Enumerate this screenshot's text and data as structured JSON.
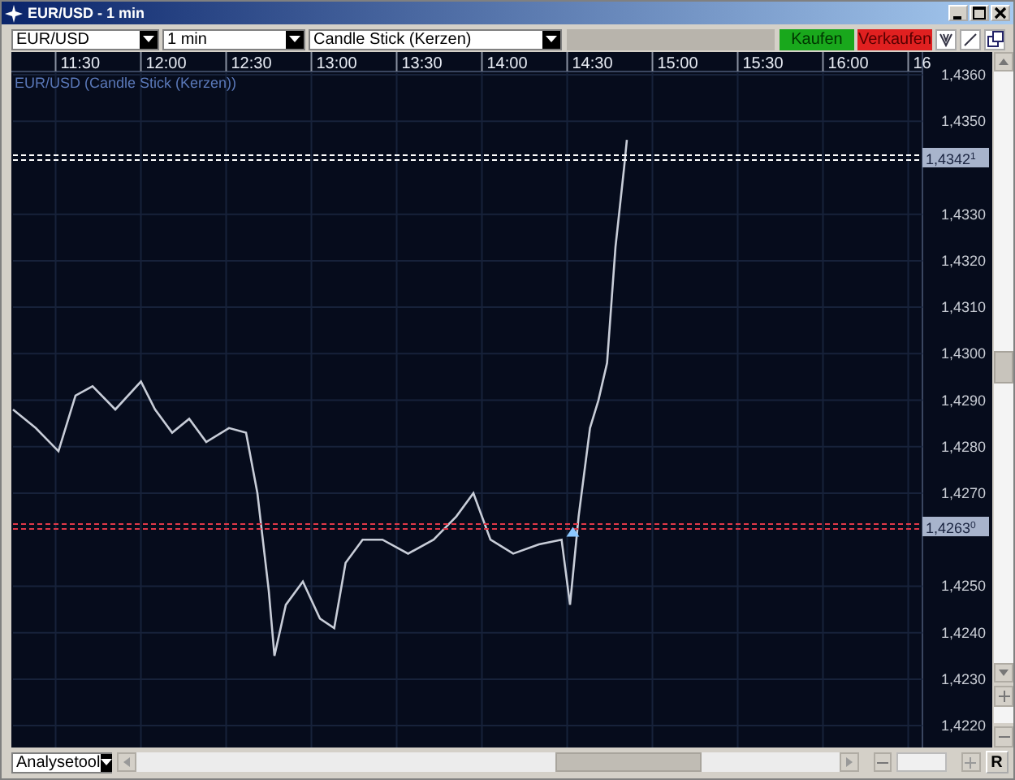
{
  "window": {
    "title": "EUR/USD - 1 min"
  },
  "toolbar": {
    "instrument": "EUR/USD",
    "interval": "1 min",
    "chart_type": "Candle Stick (Kerzen)",
    "buy_button": "Kaufen",
    "sell_button": "Verkaufen"
  },
  "chart": {
    "caption": "EUR/USD (Candle Stick (Kerzen))",
    "time_labels": [
      "11:30",
      "12:00",
      "12:30",
      "13:00",
      "13:30",
      "14:00",
      "14:30",
      "15:00",
      "15:30",
      "16:00",
      "16"
    ],
    "price_labels": [
      "1,4360",
      "1,4350",
      "1,4330",
      "1,4320",
      "1,4310",
      "1,4300",
      "1,4290",
      "1,4280",
      "1,4270",
      "1,4250",
      "1,4240",
      "1,4230",
      "1,4220"
    ],
    "price_lines": [
      {
        "label": "1,4342",
        "superscript": "1",
        "color": "#ffffff"
      },
      {
        "label": "1,4263",
        "superscript": "0",
        "color": "#e03848"
      }
    ]
  },
  "bottom_bar": {
    "tool_select": "Analysetool",
    "reset_button": "R"
  }
}
